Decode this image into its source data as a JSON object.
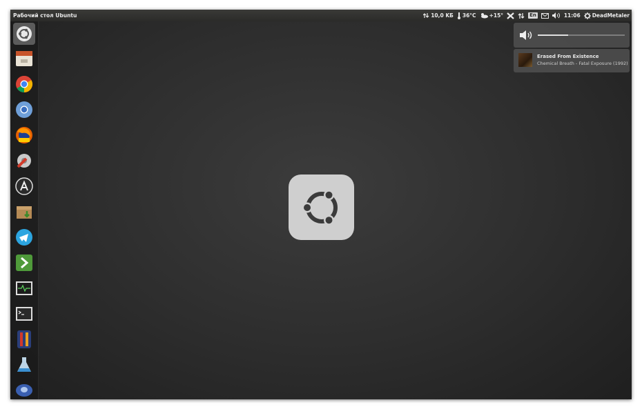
{
  "panel": {
    "title": "Рабочий стол Ubuntu",
    "network_speed": "10,0 KБ",
    "cpu_temp": "36°C",
    "weather_temp": "+15°",
    "keyboard_layout": "En",
    "time": "11:06",
    "user": "DeadMetaler",
    "icons": [
      "network-arrows-icon",
      "thermometer-icon",
      "weather-icon",
      "x-app-icon",
      "transfer-arrows-icon",
      "keyboard-icon",
      "mail-icon",
      "volume-icon",
      "gear-icon"
    ]
  },
  "launcher": {
    "items": [
      {
        "name": "dash-home-icon",
        "active": true
      },
      {
        "name": "files-icon"
      },
      {
        "name": "chrome-icon"
      },
      {
        "name": "chromium-icon"
      },
      {
        "name": "firefox-esr-icon"
      },
      {
        "name": "system-settings-icon"
      },
      {
        "name": "software-updater-icon"
      },
      {
        "name": "archive-manager-icon"
      },
      {
        "name": "telegram-icon"
      },
      {
        "name": "code-editor-icon"
      },
      {
        "name": "system-monitor-icon"
      },
      {
        "name": "terminal-icon"
      },
      {
        "name": "game-icon"
      },
      {
        "name": "flask-icon"
      },
      {
        "name": "disk-icon"
      }
    ]
  },
  "volume_osd": {
    "level": 0.35
  },
  "notification": {
    "title": "Erased From Existence",
    "subtitle": "Chemical Breath - Fatal Exposure (1992)"
  },
  "colors": {
    "panel_bg": "#2b2b29",
    "desktop": "#2d2d2d",
    "logo_bg": "#cfcfcf",
    "logo_fg": "#3b3b3b"
  }
}
